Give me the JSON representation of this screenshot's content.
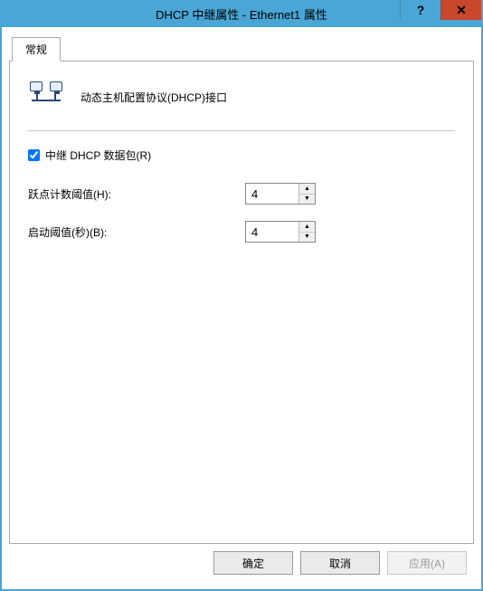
{
  "window": {
    "title": "DHCP 中继属性 - Ethernet1 属性"
  },
  "tab": {
    "general": "常规"
  },
  "panel": {
    "header_text": "动态主机配置协议(DHCP)接口",
    "relay_checkbox_label": "中继 DHCP 数据包(R)",
    "relay_checked": true,
    "hop_label": "跃点计数阈值(H):",
    "hop_value": "4",
    "boot_label": "启动阈值(秒)(B):",
    "boot_value": "4"
  },
  "buttons": {
    "ok": "确定",
    "cancel": "取消",
    "apply": "应用(A)"
  }
}
